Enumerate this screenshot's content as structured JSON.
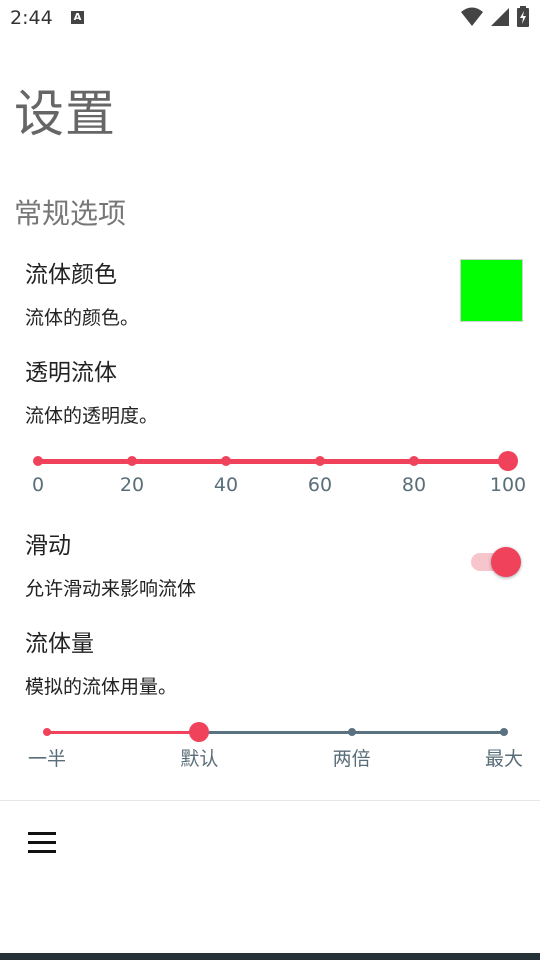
{
  "status_bar": {
    "time": "2:44",
    "notification_icon": "A"
  },
  "page": {
    "title": "设置"
  },
  "section": {
    "title": "常规选项"
  },
  "prefs": {
    "fluid_color": {
      "title": "流体颜色",
      "summary": "流体的颜色。",
      "swatch_color": "#00ff00"
    },
    "fluid_alpha": {
      "title": "透明流体",
      "summary": "流体的透明度。",
      "value": 100,
      "ticks": [
        "0",
        "20",
        "40",
        "60",
        "80",
        "100"
      ]
    },
    "swipe": {
      "title": "滑动",
      "summary": "允许滑动来影响流体",
      "enabled": true
    },
    "fluid_amount": {
      "title": "流体量",
      "summary": "模拟的流体用量。",
      "selected_index": 1,
      "ticks": [
        "一半",
        "默认",
        "两倍",
        "最大"
      ]
    }
  },
  "colors": {
    "accent": "#f0435b",
    "accent_light": "#f7c5cc",
    "inactive_track": "#5a7180",
    "muted_text": "#5a6e7a"
  },
  "icons": {
    "menu": "hamburger-menu-icon",
    "wifi": "wifi-icon",
    "signal": "signal-icon",
    "battery": "battery-charging-icon"
  }
}
